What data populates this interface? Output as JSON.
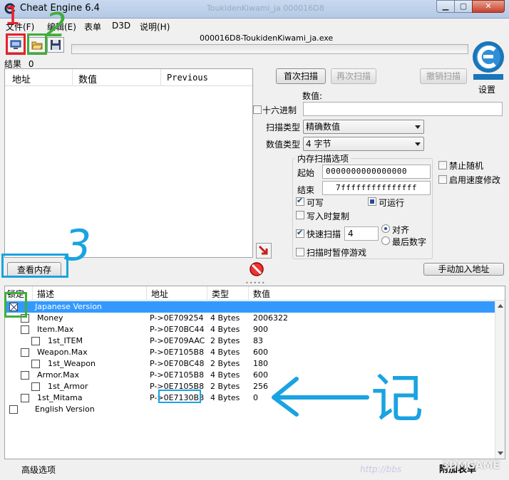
{
  "window": {
    "title": "Cheat Engine 6.4",
    "ghost_title": "ToukidenKiwami_ja 000016D8"
  },
  "menu": [
    "文件(F)",
    "编辑(E)",
    "表单",
    "D3D",
    "说明(H)"
  ],
  "toolbar": {
    "process_name": "000016D8-ToukidenKiwami_ja.exe",
    "settings_label": "设置",
    "progress": 0
  },
  "results": {
    "label": "结果",
    "count": "0",
    "columns": [
      "地址",
      "数值",
      "Previous"
    ]
  },
  "scan": {
    "first_scan": "首次扫描",
    "next_scan": "再次扫描",
    "undo_scan": "撤销扫描",
    "value_label": "数值:",
    "hex_label": "十六进制",
    "hex_checked": false,
    "scan_type_label": "扫描类型",
    "scan_type_value": "精确数值",
    "value_type_label": "数值类型",
    "value_type_value": "4 字节",
    "memory_options_title": "内存扫描选项",
    "start_label": "起始",
    "start_value": "0000000000000000",
    "stop_label": "结束",
    "stop_value": "7fffffffffffffff",
    "writable_label": "可写",
    "writable_checked": true,
    "executable_label": "可运行",
    "executable_checked": true,
    "copy_on_write_label": "写入时复制",
    "copy_on_write_checked": false,
    "fast_scan_label": "快速扫描",
    "fast_scan_checked": true,
    "fast_scan_value": "4",
    "alignment_label": "对齐",
    "alignment_on": true,
    "last_digits_label": "最后数字",
    "last_digits_on": false,
    "pause_game_label": "扫描时暂停游戏",
    "pause_game_checked": false,
    "no_random_label": "禁止随机",
    "no_random_checked": false,
    "speedhack_label": "启用速度修改",
    "speedhack_checked": false
  },
  "memory_view_button": "查看内存",
  "add_address_button": "手动加入地址",
  "address_table": {
    "columns": [
      "锁定",
      "描述",
      "地址",
      "类型",
      "数值"
    ],
    "rows": [
      {
        "description": "Japanese Version",
        "address": "",
        "type": "",
        "value": "",
        "checked": true,
        "selected": true,
        "indent": 0
      },
      {
        "description": "Money",
        "address": "P->0E709254",
        "type": "4 Bytes",
        "value": "2006322",
        "checked": false,
        "selected": false,
        "indent": 1
      },
      {
        "description": "Item.Max",
        "address": "P->0E70BC44",
        "type": "4 Bytes",
        "value": "900",
        "checked": false,
        "selected": false,
        "indent": 1
      },
      {
        "description": "1st_ITEM",
        "address": "P->0E709AAC",
        "type": "2 Bytes",
        "value": "83",
        "checked": false,
        "selected": false,
        "indent": 2
      },
      {
        "description": "Weapon.Max",
        "address": "P->0E7105B8",
        "type": "4 Bytes",
        "value": "600",
        "checked": false,
        "selected": false,
        "indent": 1
      },
      {
        "description": "1st_Weapon",
        "address": "P->0E70BC48",
        "type": "2 Bytes",
        "value": "180",
        "checked": false,
        "selected": false,
        "indent": 2
      },
      {
        "description": "Armor.Max",
        "address": "P->0E7105B8",
        "type": "4 Bytes",
        "value": "600",
        "checked": false,
        "selected": false,
        "indent": 1
      },
      {
        "description": "1st_Armor",
        "address": "P->0E7105B8",
        "type": "2 Bytes",
        "value": "256",
        "checked": false,
        "selected": false,
        "indent": 2
      },
      {
        "description": "1st_Mitama",
        "address": "P->0E7130B8",
        "type": "4 Bytes",
        "value": "0",
        "checked": false,
        "selected": false,
        "indent": 1
      },
      {
        "description": "English Version",
        "address": "",
        "type": "",
        "value": "",
        "checked": false,
        "selected": false,
        "indent": 0
      }
    ]
  },
  "footer": {
    "advanced_options": "高级选项",
    "add_table": "附加表单",
    "watermark": "http://bbs",
    "watermark_brand": "3DMGAME"
  },
  "annotations": {
    "n1": "1",
    "n2": "2",
    "n3": "3",
    "note": "记",
    "red": "#e8202a",
    "green": "#3fae3b",
    "blue": "#1aa3e0"
  }
}
